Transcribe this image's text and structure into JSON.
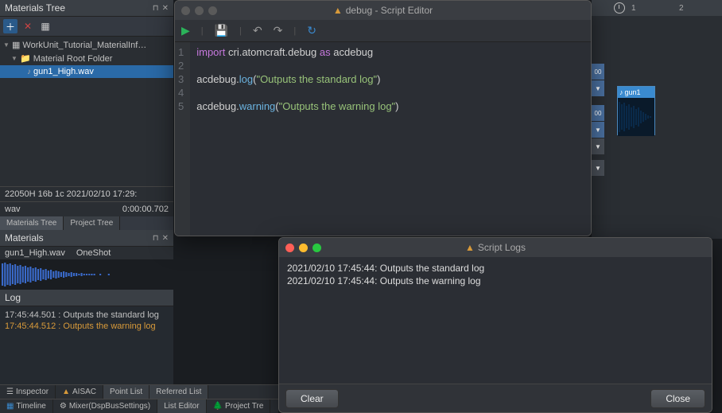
{
  "left": {
    "materials_tree_title": "Materials Tree",
    "tree": {
      "workunit": "WorkUnit_Tutorial_MaterialInf…",
      "root_folder": "Material Root Folder",
      "file": "gun1_High.wav"
    },
    "status": {
      "left": "22050H 16b 1c 2021/02/10 17:29:",
      "name": "wav",
      "duration": "0:00:00.702"
    },
    "tabs": {
      "materials_tree": "Materials Tree",
      "project_tree": "Project Tree"
    },
    "materials_title": "Materials",
    "materials_info": {
      "file": "gun1_High.wav",
      "type": "OneShot"
    },
    "log_title": "Log",
    "log_entries": [
      {
        "time": "17:45:44.501",
        "sep": " : ",
        "msg": "Outputs the standard log",
        "warn": false
      },
      {
        "time": "17:45:44.512",
        "sep": " : ",
        "msg": "Outputs the warning log",
        "warn": true
      }
    ],
    "bottom_tabs": {
      "inspector": "Inspector",
      "aisac": "AISAC",
      "point_list": "Point List",
      "referred_list": "Referred List",
      "timeline": "Timeline",
      "mixer": "Mixer(DspBusSettings)",
      "list_editor": "List Editor",
      "project_tree": "Project Tre"
    }
  },
  "editor": {
    "title": "debug - Script Editor",
    "code_lines": [
      "1",
      "2",
      "3",
      "4",
      "5"
    ],
    "code": {
      "l1_import": "import",
      "l1_module": "cri.atomcraft.debug",
      "l1_as": "as",
      "l1_alias": "acdebug",
      "l3_obj": "acdebug",
      "l3_func": "log",
      "l3_str": "\"Outputs the standard log\"",
      "l5_obj": "acdebug",
      "l5_func": "warning",
      "l5_str": "\"Outputs the warning log\""
    }
  },
  "right": {
    "ruler": {
      "r1": "1",
      "r2": "2"
    },
    "clip_label": "gun1",
    "track_val": "00"
  },
  "logs": {
    "title": "Script Logs",
    "entries": [
      "2021/02/10 17:45:44: Outputs the standard log",
      "2021/02/10 17:45:44: Outputs the warning log"
    ],
    "clear_btn": "Clear",
    "close_btn": "Close"
  }
}
